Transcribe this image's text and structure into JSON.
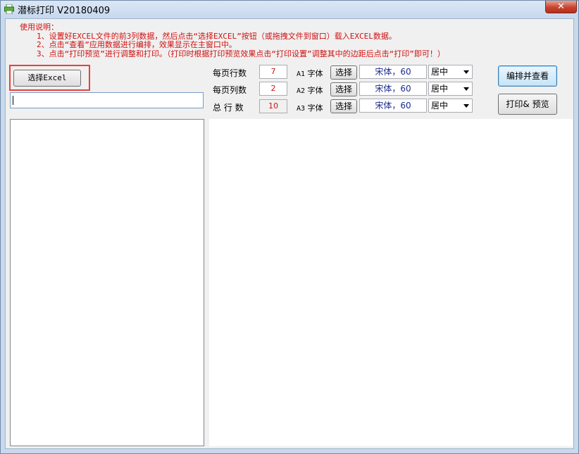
{
  "window": {
    "title": "潜标打印 V20180409",
    "close_label": "✕"
  },
  "instructions": {
    "heading": "使用说明：",
    "steps": [
      "1、设置好EXCEL文件的前3列数据，然后点击“选择EXCEL”按钮（或拖拽文件到窗口）载入EXCEL数据。",
      "2、点击“查看”应用数据进行编排，效果显示在主窗口中。",
      "3、点击“打印预览”进行调整和打印。（打印时根据打印预览效果点击“打印设置”调整其中的边距后点击“打印”即可！）"
    ]
  },
  "file": {
    "select_excel_label": "选择Excel",
    "path_value": ""
  },
  "settings": {
    "rows_per_page_label": "每页行数",
    "rows_per_page": "7",
    "cols_per_page_label": "每页列数",
    "cols_per_page": "2",
    "total_rows_label": "总 行 数",
    "total_rows": "10"
  },
  "fonts": [
    {
      "key": "A1",
      "label": "字体",
      "select_label": "选择",
      "value": "宋体，60",
      "align": "居中"
    },
    {
      "key": "A2",
      "label": "字体",
      "select_label": "选择",
      "value": "宋体，60",
      "align": "居中"
    },
    {
      "key": "A3",
      "label": "字体",
      "select_label": "选择",
      "value": "宋体，60",
      "align": "居中"
    }
  ],
  "actions": {
    "arrange_label": "编排并查看",
    "print_label": "打印& 预览"
  },
  "colors": {
    "instruction_text": "#d01010",
    "highlight_frame": "#e8413c",
    "font_value_text": "#1a2c8c"
  }
}
